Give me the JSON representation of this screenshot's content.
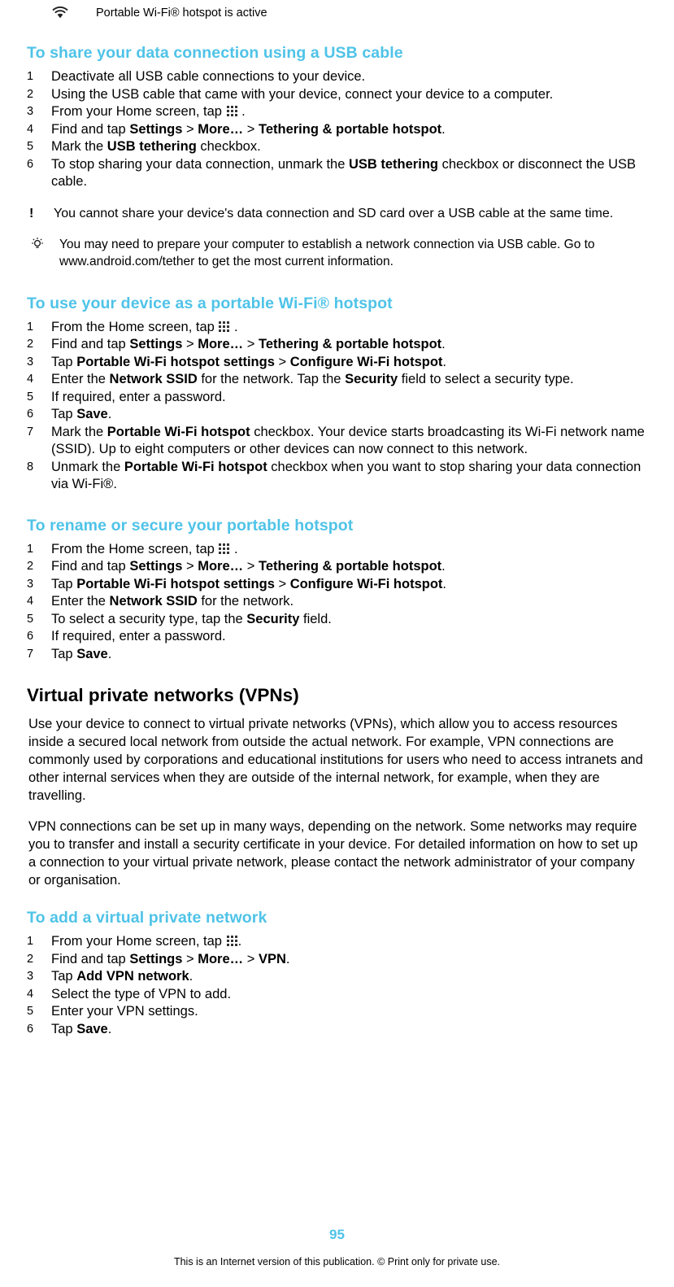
{
  "statusbar": {
    "icon": "wifi-icon",
    "text": "Portable Wi-Fi® hotspot is active"
  },
  "sections": [
    {
      "heading": "To share your data connection using a USB cable",
      "steps": [
        "Deactivate all USB cable connections to your device.",
        "Using the USB cable that came with your device, connect your device to a computer.",
        "From your Home screen, tap  .",
        "Find and tap Settings > More… > Tethering & portable hotspot.",
        "Mark the USB tethering checkbox.",
        "To stop sharing your data connection, unmark the USB tethering checkbox or disconnect the USB cable."
      ]
    },
    {
      "heading": "To use your device as a portable Wi-Fi® hotspot",
      "steps": [
        "From the Home screen, tap  .",
        "Find and tap Settings > More… > Tethering & portable hotspot.",
        "Tap Portable Wi-Fi hotspot settings > Configure Wi-Fi hotspot.",
        "Enter the Network SSID for the network. Tap the Security field to select a security type.",
        "If required, enter a password.",
        "Tap Save.",
        "Mark the Portable Wi-Fi hotspot checkbox. Your device starts broadcasting its Wi-Fi network name (SSID). Up to eight computers or other devices can now connect to this network.",
        "Unmark the Portable Wi-Fi hotspot checkbox when you want to stop sharing your data connection via Wi-Fi®."
      ]
    },
    {
      "heading": "To rename or secure your portable hotspot",
      "steps": [
        "From the Home screen, tap  .",
        "Find and tap Settings > More… > Tethering & portable hotspot.",
        "Tap Portable Wi-Fi hotspot settings > Configure Wi-Fi hotspot.",
        "Enter the Network SSID for the network.",
        "To select a security type, tap the Security field.",
        "If required, enter a password.",
        "Tap Save."
      ]
    },
    {
      "heading": "To add a virtual private network",
      "steps": [
        "From your Home screen, tap  .",
        "Find and tap Settings > More… > VPN.",
        "Tap Add VPN network.",
        "Select the type of VPN to add.",
        "Enter your VPN settings.",
        "Tap Save."
      ]
    }
  ],
  "notes": {
    "warning": "You cannot share your device's data connection and SD card over a USB cable at the same time.",
    "warning_marker": "!",
    "tip": "You may need to prepare your computer to establish a network connection via USB cable. Go to www.android.com/tether to get the most current information.",
    "tip_marker": "lightbulb-icon"
  },
  "vpn": {
    "title": "Virtual private networks (VPNs)",
    "paragraph1": "Use your device to connect to virtual private networks (VPNs), which allow you to access resources inside a secured local network from outside the actual network. For example, VPN connections are commonly used by corporations and educational institutions for users who need to access intranets and other internal services when they are outside of the internal network, for example, when they are travelling.",
    "paragraph2": "VPN connections can be set up in many ways, depending on the network. Some networks may require you to transfer and install a security certificate in your device. For detailed information on how to set up a connection to your virtual private network, please contact the network administrator of your company or organisation."
  },
  "footer": {
    "page_number": "95",
    "note": "This is an Internet version of this publication. © Print only for private use."
  },
  "colors": {
    "accent": "#4fc3e8",
    "text": "#000000"
  }
}
